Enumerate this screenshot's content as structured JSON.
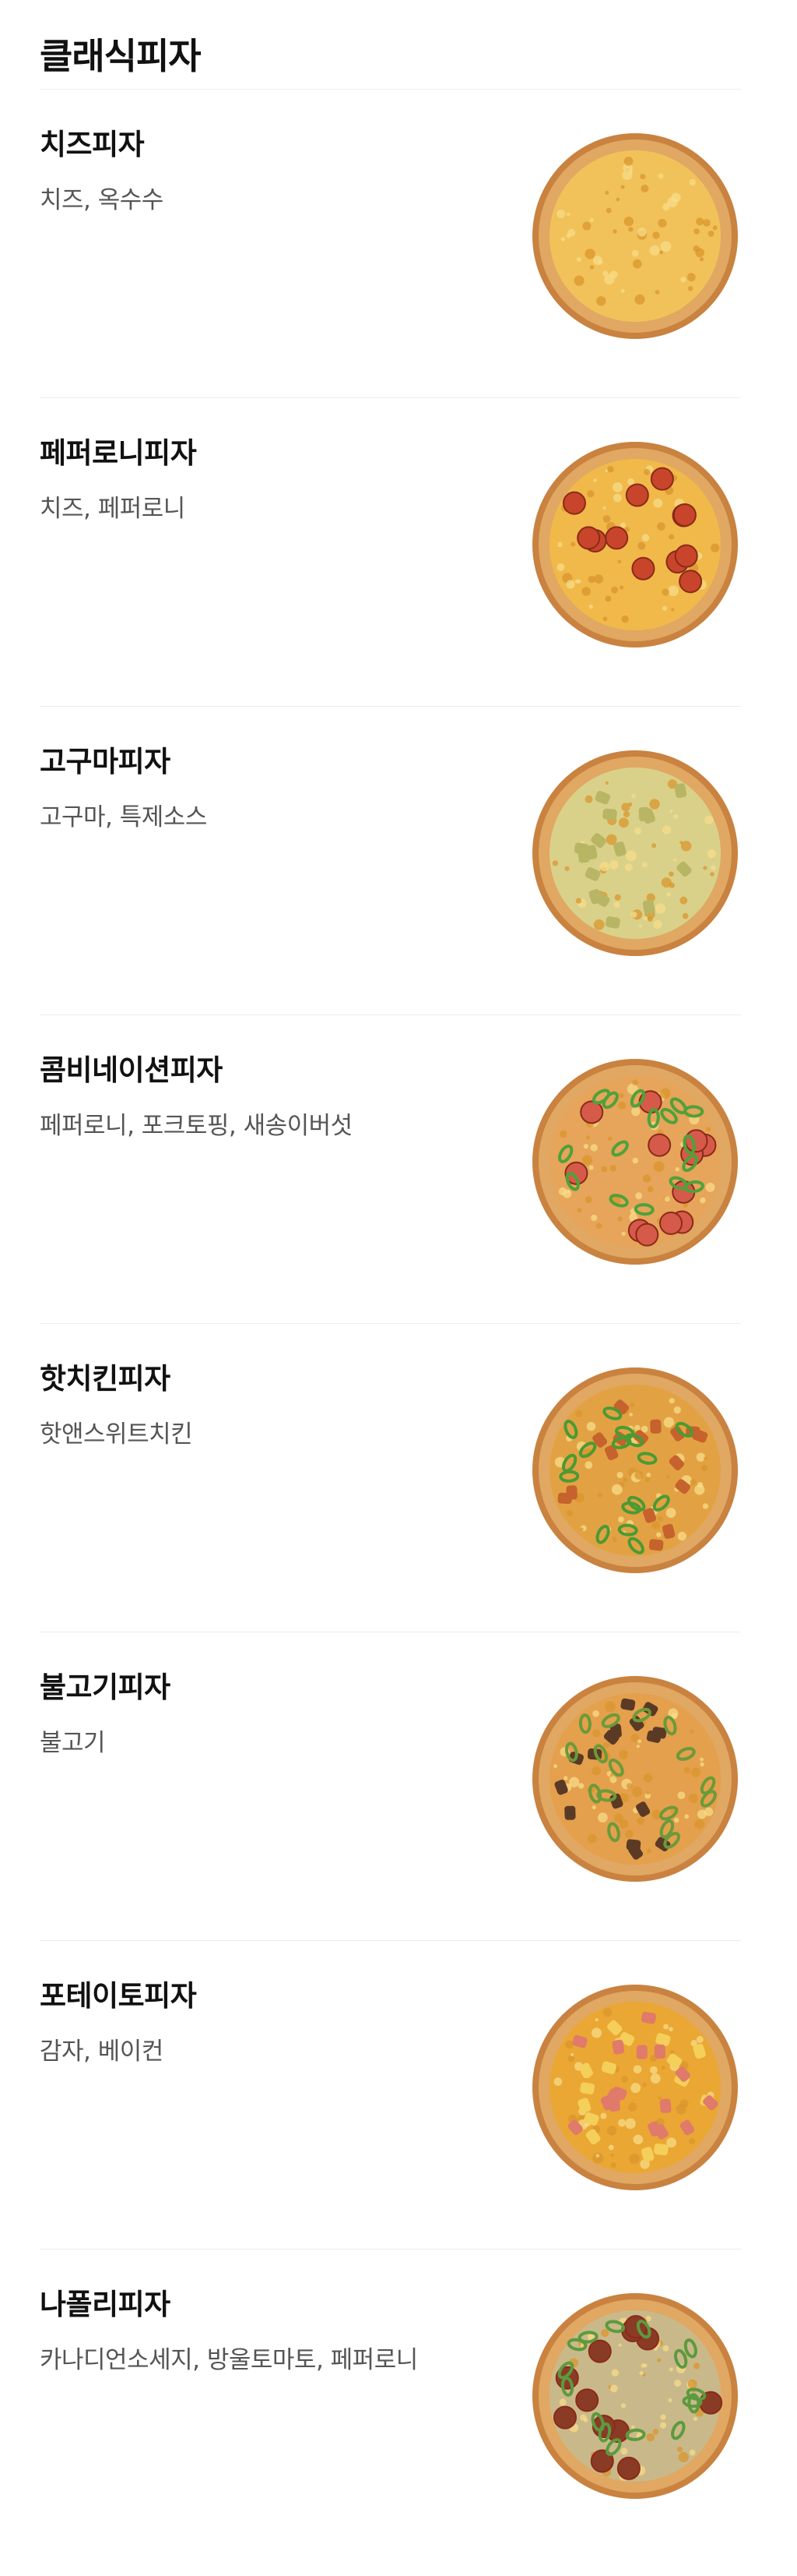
{
  "section": {
    "title": "클래식피자"
  },
  "items": [
    {
      "name": "치즈피자",
      "desc": "치즈, 옥수수",
      "icon": "cheese-pizza-image",
      "sauce": "#f2c25a",
      "toppings": []
    },
    {
      "name": "페퍼로니피자",
      "desc": "치즈, 페퍼로니",
      "icon": "pepperoni-pizza-image",
      "sauce": "#f0b94a",
      "toppings": [
        {
          "shape": "circle",
          "color": "#c8452b"
        }
      ]
    },
    {
      "name": "고구마피자",
      "desc": "고구마, 특제소스",
      "icon": "sweet-potato-pizza-image",
      "sauce": "#d9d18a",
      "toppings": [
        {
          "shape": "chunk",
          "color": "#b8b565"
        }
      ]
    },
    {
      "name": "콤비네이션피자",
      "desc": "페퍼로니, 포크토핑, 새송이버섯",
      "icon": "combination-pizza-image",
      "sauce": "#e6a55a",
      "toppings": [
        {
          "shape": "circle",
          "color": "#d65a4a"
        },
        {
          "shape": "ring",
          "color": "#4fa13a"
        }
      ]
    },
    {
      "name": "핫치킨피자",
      "desc": "핫앤스위트치킨",
      "icon": "hot-chicken-pizza-image",
      "sauce": "#e2a243",
      "toppings": [
        {
          "shape": "chunk",
          "color": "#c5622d"
        },
        {
          "shape": "ring",
          "color": "#4b9a33"
        }
      ]
    },
    {
      "name": "불고기피자",
      "desc": "불고기",
      "icon": "bulgogi-pizza-image",
      "sauce": "#e4a04c",
      "toppings": [
        {
          "shape": "chunk",
          "color": "#5b3a25"
        },
        {
          "shape": "ring",
          "color": "#6b9a3a"
        }
      ]
    },
    {
      "name": "포테이토피자",
      "desc": "감자, 베이컨",
      "icon": "potato-pizza-image",
      "sauce": "#eaa733",
      "toppings": [
        {
          "shape": "chunk",
          "color": "#f4cf5a"
        },
        {
          "shape": "chunk",
          "color": "#e07a6a"
        }
      ]
    },
    {
      "name": "나폴리피자",
      "desc": "카나디언소세지, 방울토마토, 페퍼로니",
      "icon": "napoli-pizza-image",
      "sauce": "#c9b98a",
      "toppings": [
        {
          "shape": "circle",
          "color": "#8a3b26"
        },
        {
          "shape": "ring",
          "color": "#5c9a3e"
        }
      ]
    }
  ]
}
